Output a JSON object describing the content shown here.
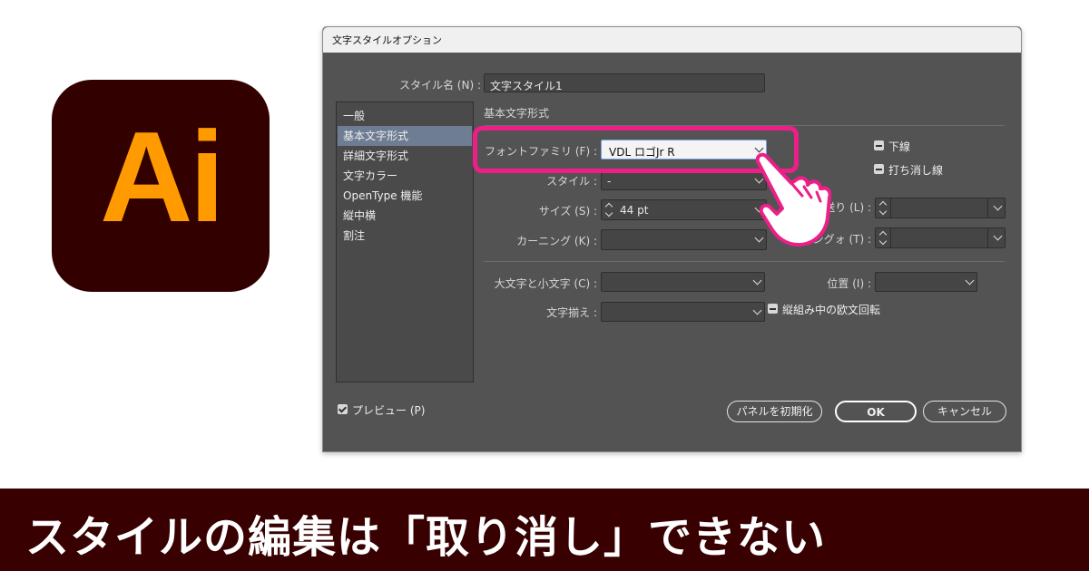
{
  "logo": {
    "text": "Ai",
    "bg": "#330000",
    "fg": "#FF9A00"
  },
  "dialog": {
    "title": "文字スタイルオプション",
    "style_name_label": "スタイル名 (N) :",
    "style_name_value": "文字スタイル1",
    "section_title": "基本文字形式",
    "sidebar": [
      {
        "label": "一般",
        "selected": false
      },
      {
        "label": "基本文字形式",
        "selected": true
      },
      {
        "label": "詳細文字形式",
        "selected": false
      },
      {
        "label": "文字カラー",
        "selected": false
      },
      {
        "label": "OpenType 機能",
        "selected": false
      },
      {
        "label": "縦中横",
        "selected": false
      },
      {
        "label": "割注",
        "selected": false
      }
    ],
    "font_family_label": "フォントファミリ (F) :",
    "font_family_value": "VDL ロゴJr R",
    "style_label": "スタイル :",
    "style_value": "-",
    "size_label": "サイズ (S) :",
    "size_value": "44 pt",
    "leading_label": "行送り (L) :",
    "kerning_label": "カーニング (K) :",
    "tracking_label": "ングォ (T) :",
    "case_label": "大文字と小文字 (C) :",
    "position_label": "位置 (I) :",
    "alignment_label": "文字揃え :",
    "underline_label": "下線",
    "strikethrough_label": "打ち消し線",
    "rotate_roman_label": "縦組み中の欧文回転",
    "preview_label": "プレビュー (P)",
    "reset_button": "パネルを初期化",
    "ok_button": "OK",
    "cancel_button": "キャンセル",
    "highlight_color": "#EE1E88"
  },
  "banner": {
    "text": "スタイルの編集は「取り消し」できない",
    "bg": "#380000"
  }
}
